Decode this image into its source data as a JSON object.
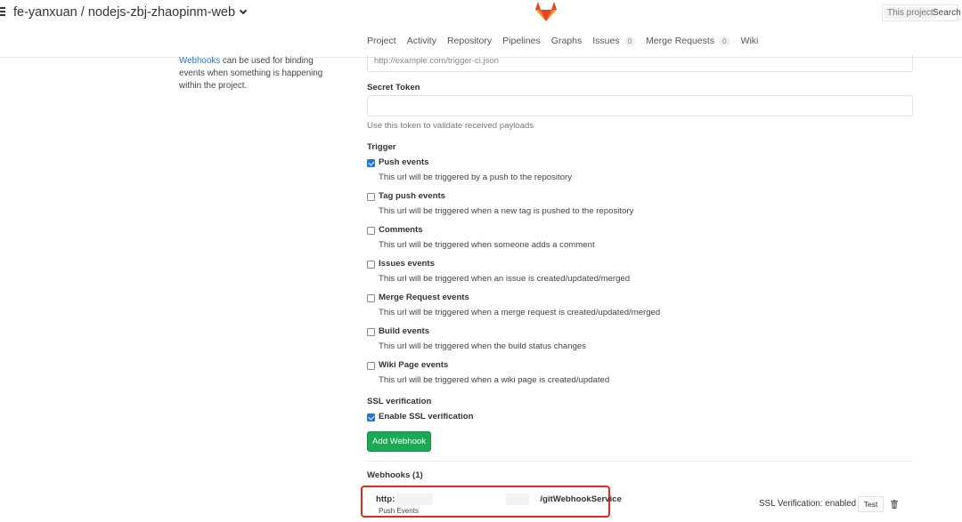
{
  "header": {
    "title": "fe-yanxuan / nodejs-zbj-zhaopinm-web",
    "search_scope": "This project",
    "search_placeholder": "Search"
  },
  "nav": {
    "items": [
      {
        "label": "Project"
      },
      {
        "label": "Activity"
      },
      {
        "label": "Repository"
      },
      {
        "label": "Pipelines"
      },
      {
        "label": "Graphs"
      },
      {
        "label": "Issues",
        "badge": "0"
      },
      {
        "label": "Merge Requests",
        "badge": "0"
      },
      {
        "label": "Wiki"
      }
    ]
  },
  "sidebar": {
    "link_text": "Webhooks",
    "text": " can be used for binding events when something is happening within the project."
  },
  "form": {
    "url_placeholder": "http://example.com/trigger-ci.json",
    "secret_label": "Secret Token",
    "secret_help": "Use this token to validate received payloads",
    "trigger_label": "Trigger",
    "triggers": [
      {
        "label": "Push events",
        "help": "This url will be triggered by a push to the repository",
        "checked": true
      },
      {
        "label": "Tag push events",
        "help": "This url will be triggered when a new tag is pushed to the repository",
        "checked": false
      },
      {
        "label": "Comments",
        "help": "This url will be triggered when someone adds a comment",
        "checked": false
      },
      {
        "label": "Issues events",
        "help": "This url will be triggered when an issue is created/updated/merged",
        "checked": false
      },
      {
        "label": "Merge Request events",
        "help": "This url will be triggered when a merge request is created/updated/merged",
        "checked": false
      },
      {
        "label": "Build events",
        "help": "This url will be triggered when the build status changes",
        "checked": false
      },
      {
        "label": "Wiki Page events",
        "help": "This url will be triggered when a wiki page is created/updated",
        "checked": false
      }
    ],
    "ssl_label": "SSL verification",
    "ssl_checkbox_label": "Enable SSL verification",
    "ssl_checked": true,
    "add_button": "Add Webhook"
  },
  "webhooks": {
    "title": "Webhooks (1)",
    "items": [
      {
        "url_prefix": "http:",
        "url_suffix": "/gitWebhookService",
        "events": "Push Events",
        "ssl_status": "SSL Verification: enabled",
        "test_label": "Test"
      }
    ]
  },
  "colors": {
    "link": "#1f78d1",
    "success": "#1aaa55",
    "highlight": "#e22a1d",
    "logo_primary": "#e24329",
    "logo_secondary": "#fc6d26",
    "logo_tertiary": "#fca326"
  }
}
